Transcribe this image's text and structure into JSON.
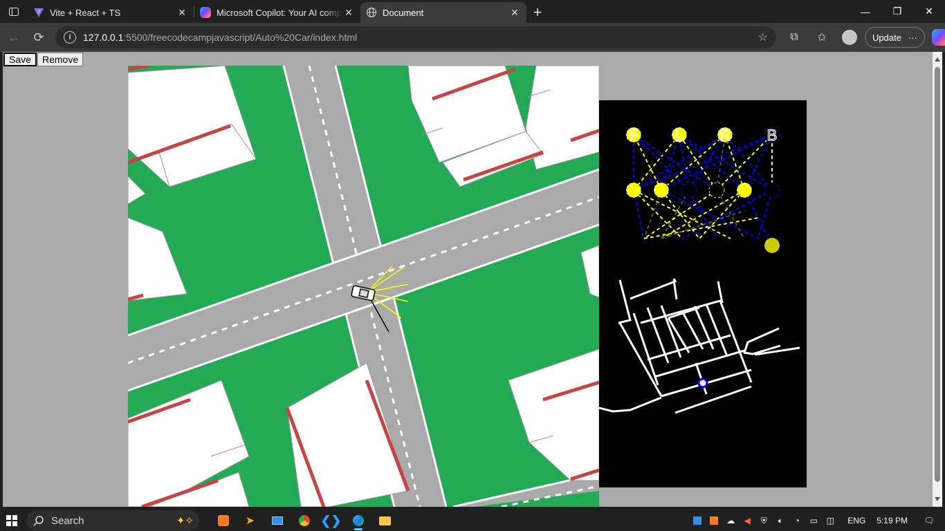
{
  "browser": {
    "tabs": [
      {
        "title": "Vite + React + TS",
        "icon": "vite-icon",
        "active": false
      },
      {
        "title": "Microsoft Copilot: Your AI compa",
        "icon": "copilot-icon",
        "active": false
      },
      {
        "title": "Document",
        "icon": "globe-icon",
        "active": true
      }
    ],
    "url_host": "127.0.0.1",
    "url_path": ":5500/freecodecampjavascript/Auto%20Car/index.html",
    "update_label": "Update",
    "more_label": "···"
  },
  "page": {
    "save_label": "Save",
    "remove_label": "Remove"
  },
  "network": {
    "output_labels": [
      "F",
      "L",
      "R",
      "B"
    ],
    "colors": {
      "active": "#ffff00",
      "negative": "#0000ff",
      "dim": "#555555"
    }
  },
  "colors": {
    "grass": "#22aa55",
    "road": "#aaaaaa",
    "house": "#ffffff",
    "roof_edge": "#c84444",
    "page_bg": "#aaaaaa",
    "sensor": "#ffff00"
  },
  "taskbar": {
    "search_placeholder": "Search",
    "language": "ENG",
    "time": "5:19 PM"
  }
}
